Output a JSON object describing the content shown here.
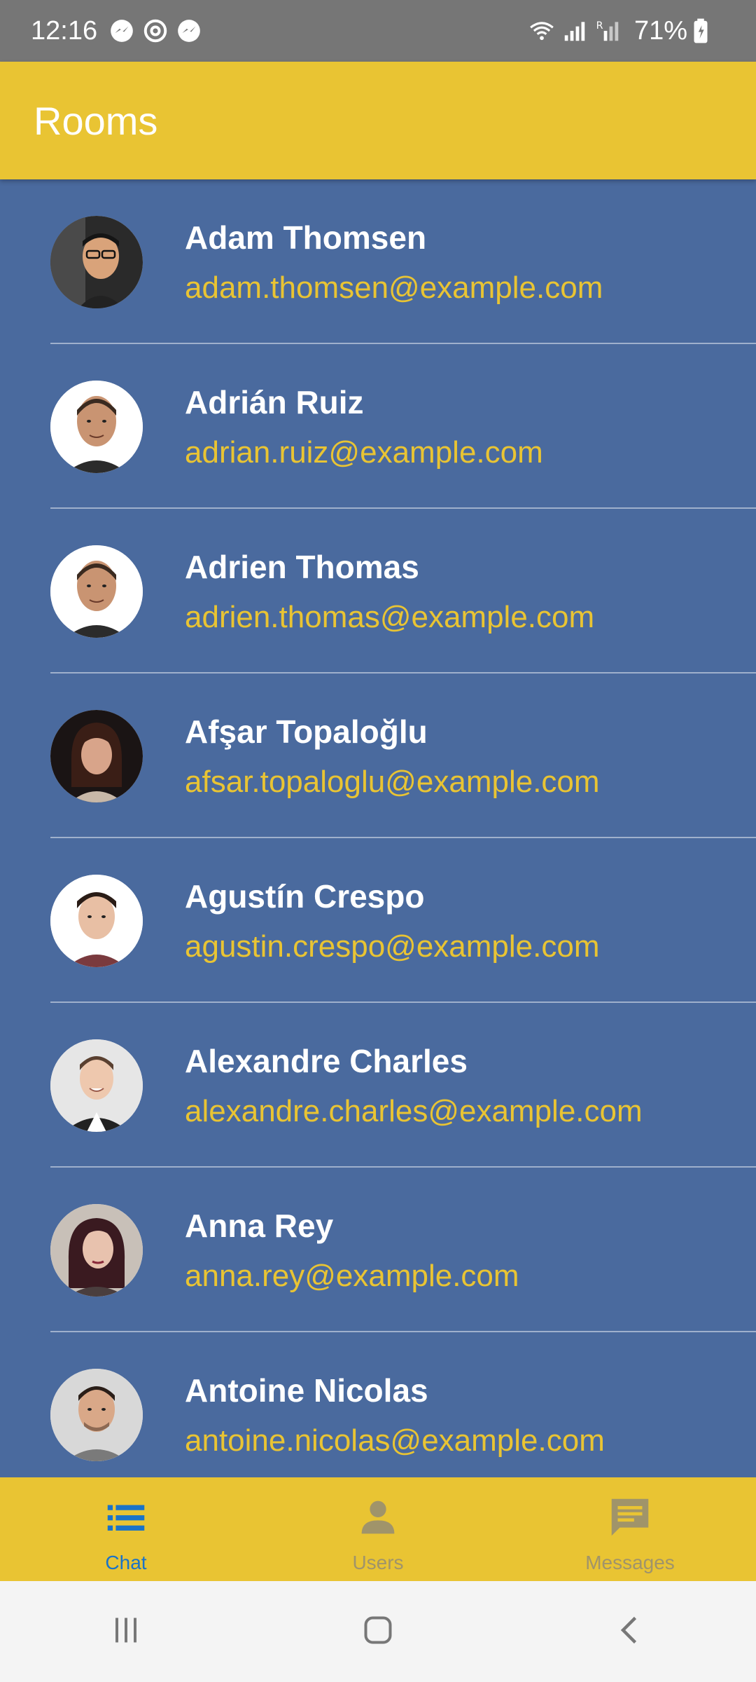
{
  "status_bar": {
    "time": "12:16",
    "battery": "71%",
    "icons": [
      "messenger-icon",
      "sync-icon",
      "messenger-icon",
      "wifi-icon",
      "signal-icon",
      "signal-r-icon",
      "battery-icon"
    ]
  },
  "app_bar": {
    "title": "Rooms"
  },
  "users": [
    {
      "name": "Adam Thomsen",
      "email": "adam.thomsen@example.com"
    },
    {
      "name": "Adrián Ruiz",
      "email": "adrian.ruiz@example.com"
    },
    {
      "name": "Adrien Thomas",
      "email": "adrien.thomas@example.com"
    },
    {
      "name": "Afşar Topaloğlu",
      "email": "afsar.topaloglu@example.com"
    },
    {
      "name": "Agustín Crespo",
      "email": "agustin.crespo@example.com"
    },
    {
      "name": "Alexandre Charles",
      "email": "alexandre.charles@example.com"
    },
    {
      "name": "Anna Rey",
      "email": "anna.rey@example.com"
    },
    {
      "name": "Antoine Nicolas",
      "email": "antoine.nicolas@example.com"
    }
  ],
  "bottom_nav": {
    "items": [
      {
        "label": "Chat",
        "icon": "list-icon",
        "active": true
      },
      {
        "label": "Users",
        "icon": "person-icon",
        "active": false
      },
      {
        "label": "Messages",
        "icon": "message-icon",
        "active": false
      }
    ]
  },
  "colors": {
    "primary": "#e9c433",
    "list_background": "#4a6a9e",
    "active_tab": "#1a73c8",
    "inactive_tab": "#a0946a",
    "email_text": "#e9c433"
  }
}
